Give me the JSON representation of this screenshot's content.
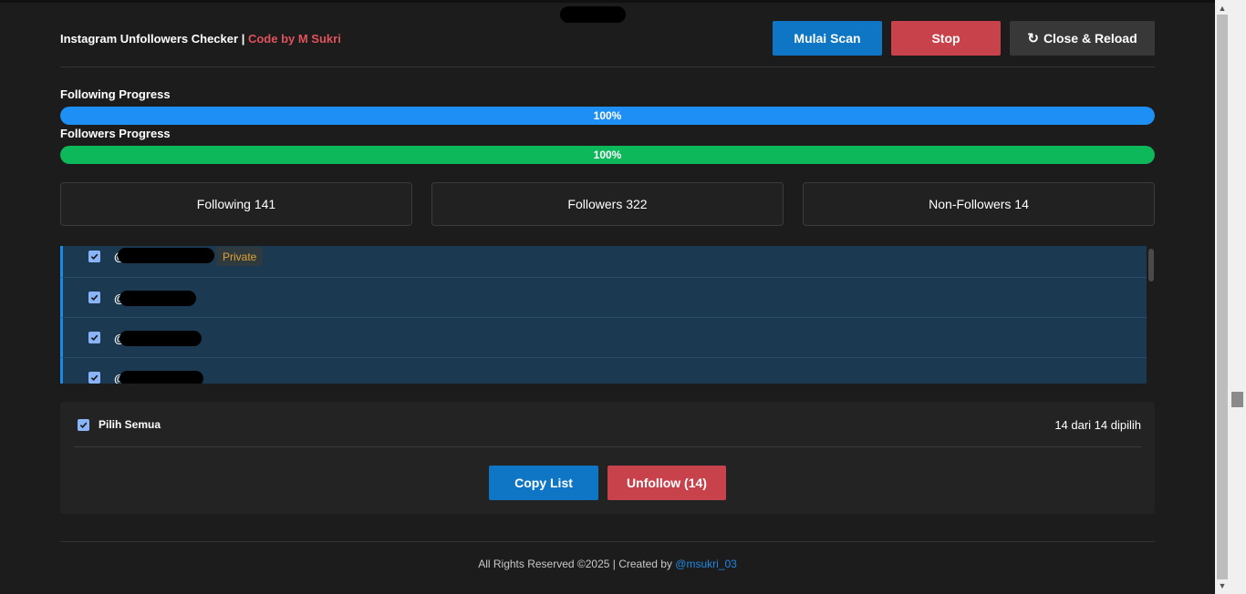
{
  "header": {
    "title": "Instagram Unfollowers Checker",
    "separator": "|",
    "credit": "Code by M Sukri",
    "scan_label": "Mulai Scan",
    "stop_label": "Stop",
    "reload_icon": "reload-icon",
    "reload_label": "Close & Reload"
  },
  "progress": {
    "following": {
      "label": "Following Progress",
      "value_text": "100%",
      "fraction": 1.0,
      "color": "#1e90f5"
    },
    "followers": {
      "label": "Followers Progress",
      "value_text": "100%",
      "fraction": 1.0,
      "color": "#0cb85a"
    }
  },
  "stats": [
    {
      "label": "Following",
      "value": "141"
    },
    {
      "label": "Followers",
      "value": "322"
    },
    {
      "label": "Non-Followers",
      "value": "14"
    }
  ],
  "list": {
    "items": [
      {
        "at": "@",
        "checked": true,
        "badge": "Private"
      },
      {
        "at": "@",
        "checked": true,
        "badge": ""
      },
      {
        "at": "@",
        "checked": true,
        "badge": ""
      },
      {
        "at": "@",
        "checked": true,
        "badge": ""
      }
    ]
  },
  "actions": {
    "select_all_label": "Pilih Semua",
    "selected_count": "14 dari 14 dipilih",
    "copy_label": "Copy List",
    "unfollow_label": "Unfollow (14)"
  },
  "footer": {
    "text": "All Rights Reserved ©2025 | Created by",
    "link": "@msukri_03"
  },
  "colors": {
    "accent_blue": "#0f76c6",
    "accent_red": "#c8424c",
    "row_bg": "#1b3a52",
    "badge_text": "#e0a030"
  }
}
